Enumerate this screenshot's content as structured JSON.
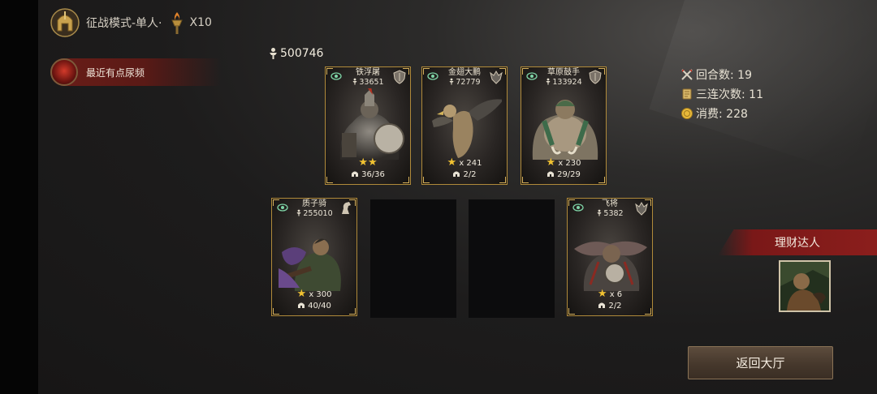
{
  "header": {
    "mode_label": "征战模式-单人·",
    "multiplier": "X10"
  },
  "message": {
    "text": "最近有点尿频"
  },
  "total_power": "500746",
  "stats": {
    "rounds": "回合数: 19",
    "triples": "三连次数: 11",
    "cost": "消费: 228"
  },
  "cards": [
    {
      "name": "铁浮屠",
      "power": "33651",
      "stars": "★★",
      "count": "",
      "troops": "36/36",
      "class_icon": "shield-icon"
    },
    {
      "name": "金翅大鹏",
      "power": "72779",
      "stars": "★",
      "count": "x 241",
      "troops": "2/2",
      "class_icon": "wing-crest-icon"
    },
    {
      "name": "草原鼓手",
      "power": "133924",
      "stars": "★",
      "count": "x 230",
      "troops": "29/29",
      "class_icon": "shield-icon"
    },
    {
      "name": "质子骑",
      "power": "255010",
      "stars": "★",
      "count": "x 300",
      "troops": "40/40",
      "class_icon": "horse-icon"
    },
    {
      "name": "飞将",
      "power": "5382",
      "stars": "★",
      "count": "x 6",
      "troops": "2/2",
      "class_icon": "wing-crest-icon"
    }
  ],
  "player": {
    "title": "理财达人"
  },
  "back_button": {
    "label": "返回大厅"
  },
  "colors": {
    "gold_border": "#b08a3a",
    "banner_red": "#7a1818",
    "star": "#f1c232"
  }
}
